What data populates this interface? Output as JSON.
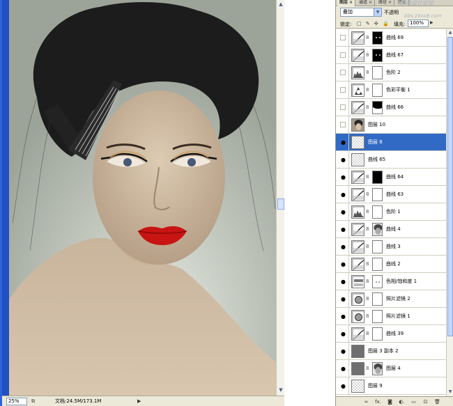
{
  "document": {
    "zoom": "25%",
    "doc_info": "文档:24.5M/173.1M",
    "play_arrow": "▶"
  },
  "layers_panel": {
    "tabs": [
      {
        "label": "图层",
        "close": "×"
      },
      {
        "label": "通道",
        "close": "×"
      },
      {
        "label": "路径",
        "close": "×"
      },
      {
        "label": "历史"
      }
    ],
    "watermark": "思缘设计论坛",
    "watermark_url": "bbs.16xx8.com",
    "blend_mode": "叠加",
    "opacity_label": "不透明",
    "opacity_value": "100%",
    "lock_label": "锁定:",
    "lock_icons": "□ ✎ ✣ 🔒",
    "fill_label": "填充:",
    "fill_value": "100%",
    "layers": [
      {
        "name": "曲线 69",
        "visible": false,
        "kind": "curves",
        "mask": "black-dots"
      },
      {
        "name": "曲线 67",
        "visible": false,
        "kind": "curves",
        "mask": "black-dots"
      },
      {
        "name": "色阶 2",
        "visible": false,
        "kind": "levels",
        "mask": "white"
      },
      {
        "name": "色彩平衡 1",
        "visible": false,
        "kind": "balance",
        "mask": "white"
      },
      {
        "name": "曲线 66",
        "visible": false,
        "kind": "curves",
        "mask": "black-top"
      },
      {
        "name": "图层 10",
        "visible": false,
        "kind": "photo",
        "mask": "none"
      },
      {
        "name": "图层 8",
        "visible": true,
        "selected": true,
        "kind": "transparent",
        "mask": "none"
      },
      {
        "name": "曲线 65",
        "visible": true,
        "kind": "transparent",
        "mask": "none"
      },
      {
        "name": "曲线 64",
        "visible": true,
        "kind": "curves",
        "mask": "black"
      },
      {
        "name": "曲线 63",
        "visible": true,
        "kind": "curves",
        "mask": "white"
      },
      {
        "name": "色阶 1",
        "visible": true,
        "kind": "levels",
        "mask": "white"
      },
      {
        "name": "曲线 4",
        "visible": true,
        "kind": "curves",
        "mask": "face"
      },
      {
        "name": "曲线 3",
        "visible": true,
        "kind": "curves",
        "mask": "white"
      },
      {
        "name": "曲线 2",
        "visible": true,
        "kind": "curves",
        "mask": "white"
      },
      {
        "name": "色相/饱和度 1",
        "visible": true,
        "kind": "huesat",
        "mask": "dots"
      },
      {
        "name": "照片滤镜 2",
        "visible": true,
        "kind": "filter",
        "mask": "white"
      },
      {
        "name": "照片滤镜 1",
        "visible": true,
        "kind": "filter",
        "mask": "white"
      },
      {
        "name": "曲线 39",
        "visible": true,
        "kind": "curves",
        "mask": "white"
      },
      {
        "name": "图层 3 副本 2",
        "visible": true,
        "kind": "gray",
        "mask": "none"
      },
      {
        "name": "图层 4",
        "visible": true,
        "kind": "gray",
        "mask": "face"
      },
      {
        "name": "图层 9",
        "visible": true,
        "kind": "transparent",
        "mask": "none"
      }
    ],
    "bottom_icons": [
      "∞",
      "fx.",
      "◙",
      "◐.",
      "▭",
      "⊡",
      "🗑"
    ]
  }
}
